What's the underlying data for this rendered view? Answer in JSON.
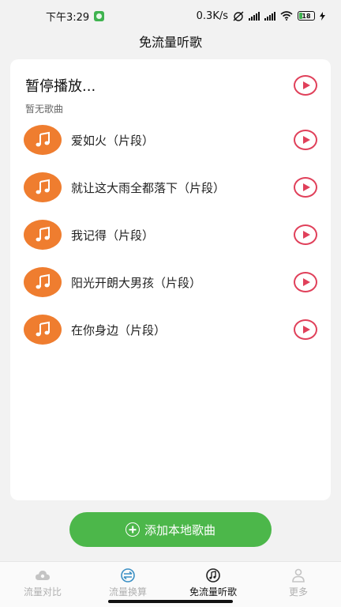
{
  "status_bar": {
    "time": "下午3:29",
    "speed": "0.3K/s",
    "battery": "18"
  },
  "page": {
    "title": "免流量听歌"
  },
  "now_playing": {
    "title": "暂停播放...",
    "subtitle": "暂无歌曲"
  },
  "songs": [
    {
      "title": "爱如火（片段）"
    },
    {
      "title": "就让这大雨全都落下（片段）"
    },
    {
      "title": "我记得（片段）"
    },
    {
      "title": "阳光开朗大男孩（片段）"
    },
    {
      "title": "在你身边（片段）"
    }
  ],
  "add_button": {
    "label": "添加本地歌曲"
  },
  "tabs": [
    {
      "label": "流量对比",
      "icon": "cloud-icon",
      "active": false
    },
    {
      "label": "流量换算",
      "icon": "exchange-icon",
      "active": false
    },
    {
      "label": "免流量听歌",
      "icon": "music-icon",
      "active": true
    },
    {
      "label": "更多",
      "icon": "user-icon",
      "active": false
    }
  ],
  "colors": {
    "accent_green": "#4cb74a",
    "play_red": "#e0405a",
    "avatar_orange": "#ef7d2f"
  }
}
